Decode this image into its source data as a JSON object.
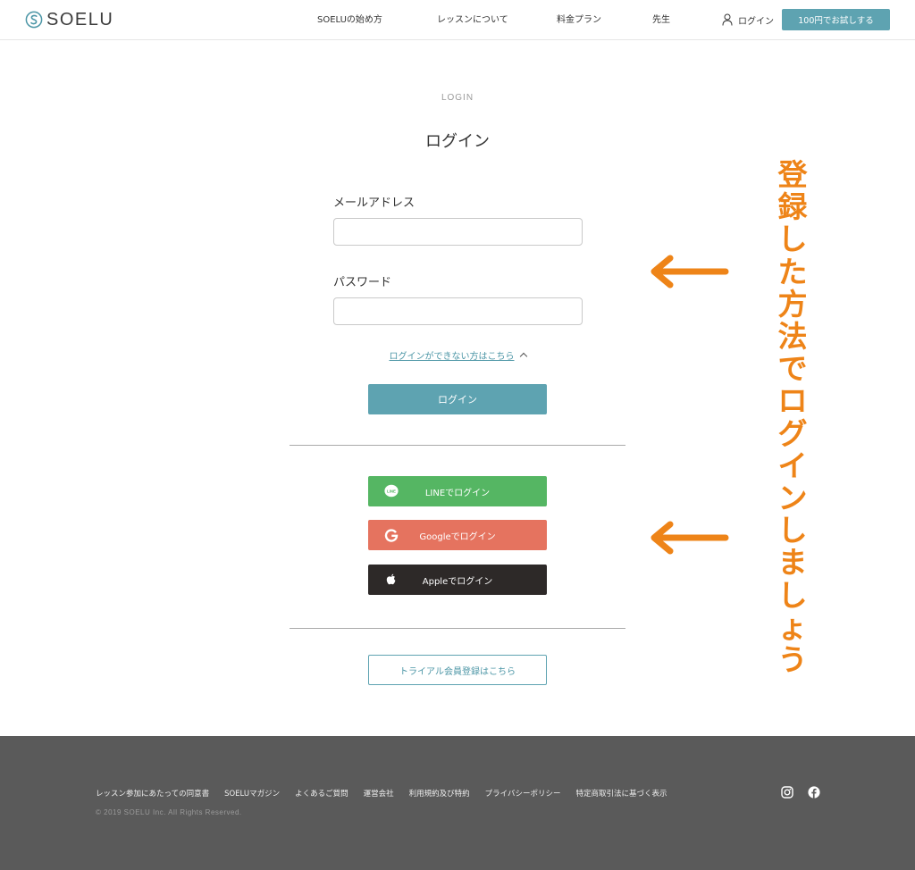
{
  "header": {
    "logo_text": "SOELU",
    "nav": [
      {
        "label": "SOELUの始め方"
      },
      {
        "label": "レッスンについて"
      },
      {
        "label": "料金プラン"
      },
      {
        "label": "先生"
      }
    ],
    "login_label": "ログイン",
    "trial_button": "100円でお試しする"
  },
  "main": {
    "eyebrow": "LOGIN",
    "title": "ログイン",
    "email_label": "メールアドレス",
    "email_value": "",
    "password_label": "パスワード",
    "password_value": "",
    "help_link": "ログインができない方はこちら",
    "login_button": "ログイン",
    "line_button": "LINEでログイン",
    "line_icon_text": "LINE",
    "google_button": "Googleでログイン",
    "apple_button": "Appleでログイン",
    "trial_register_button": "トライアル会員登録はこちら"
  },
  "annotation": {
    "text": "登録した方法でログインしましょう",
    "chars": [
      "登",
      "録",
      "し",
      "た",
      "方",
      "法",
      "で",
      "ロ",
      "グ",
      "イ",
      "ン",
      "し",
      "ま",
      "し",
      "ょ",
      "う"
    ],
    "color": "#ee8418"
  },
  "footer": {
    "links": [
      "レッスン参加にあたっての同意書",
      "SOELUマガジン",
      "よくあるご質問",
      "運営会社",
      "利用規約及び特約",
      "プライバシーポリシー",
      "特定商取引法に基づく表示"
    ],
    "copyright": "© 2019 SOELU Inc. All Rights Reserved."
  },
  "colors": {
    "brand_teal": "#5ea3b1",
    "line_green": "#55b663",
    "google_red": "#e5735f",
    "apple_black": "#2d2928",
    "footer_gray": "#5a5a5a",
    "annotation_orange": "#ee8418"
  },
  "icons": {
    "logo": "soelu-s-logo-icon",
    "user": "user-icon",
    "chevron": "chevron-up-icon",
    "line": "line-icon",
    "google": "google-icon",
    "apple": "apple-icon",
    "instagram": "instagram-icon",
    "facebook": "facebook-icon",
    "arrow": "left-arrow-icon"
  }
}
